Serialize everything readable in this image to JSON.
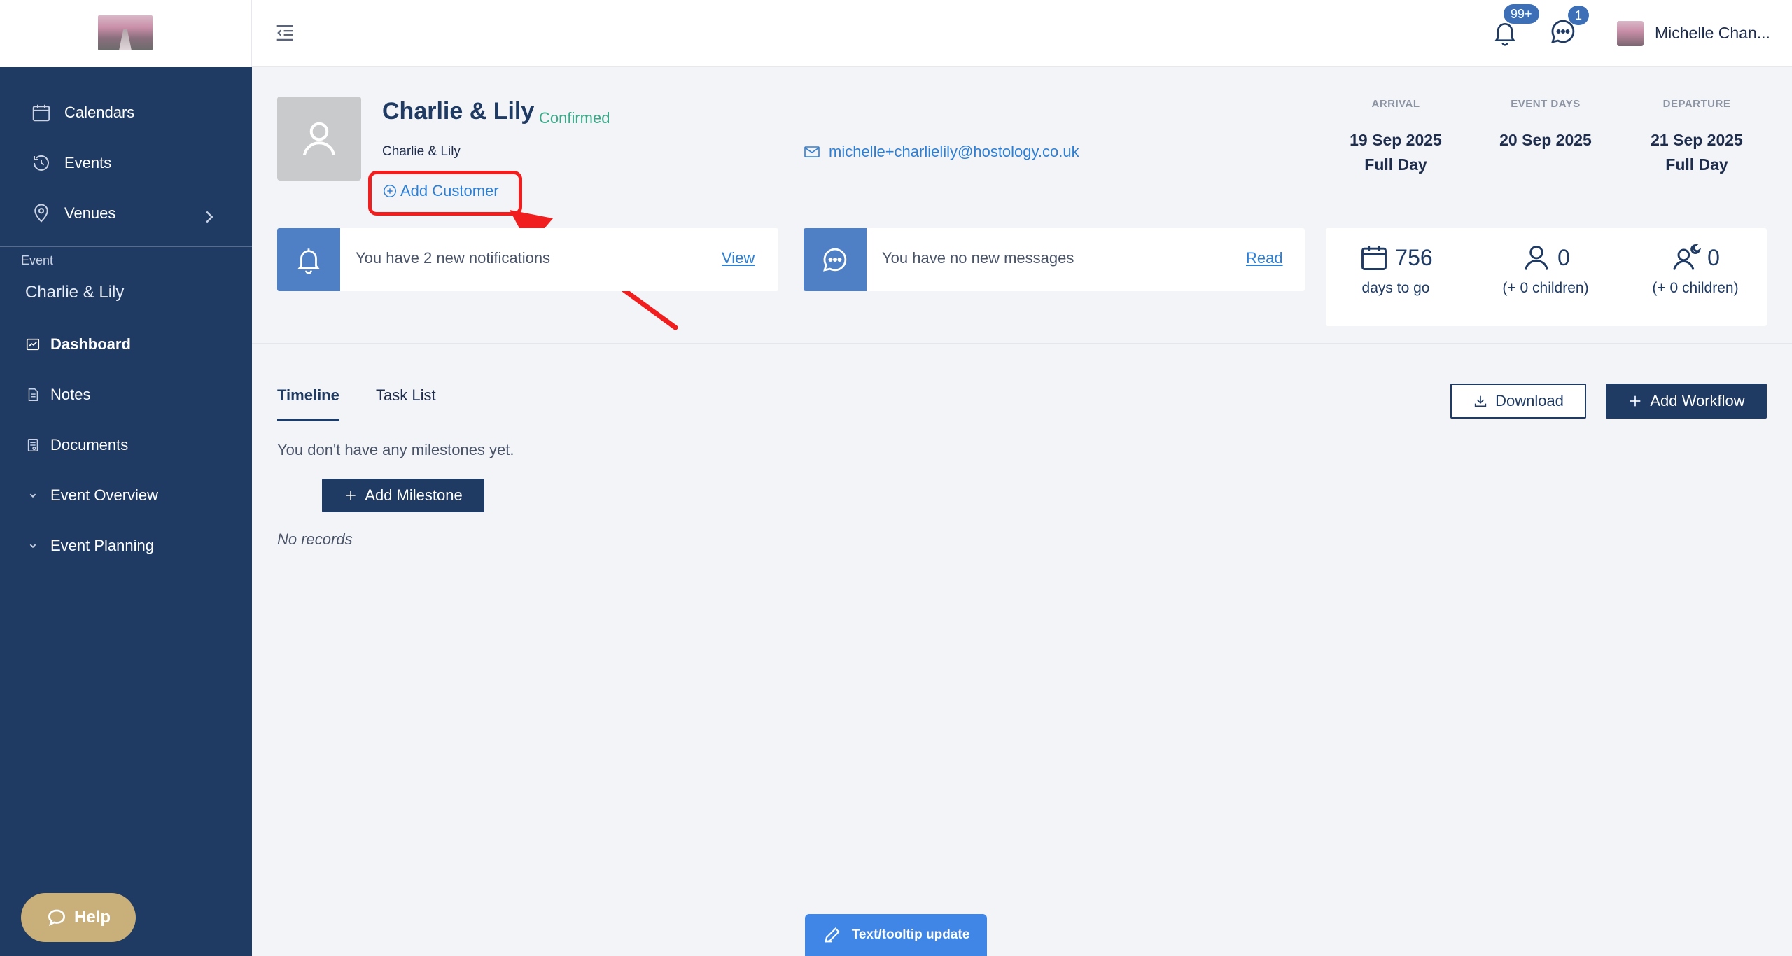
{
  "sidebar": {
    "nav": [
      {
        "label": "Calendars",
        "icon": "calendar-icon"
      },
      {
        "label": "Events",
        "icon": "clock-history-icon"
      },
      {
        "label": "Venues",
        "icon": "map-pin-icon"
      }
    ],
    "section_label": "Event",
    "event_name": "Charlie & Lily",
    "sub_nav": [
      {
        "label": "Dashboard",
        "icon": "dashboard-icon",
        "active": true
      },
      {
        "label": "Notes",
        "icon": "note-icon"
      },
      {
        "label": "Documents",
        "icon": "document-icon"
      },
      {
        "label": "Event Overview",
        "icon": "chevron-down-icon"
      },
      {
        "label": "Event Planning",
        "icon": "chevron-down-icon"
      }
    ],
    "help_label": "Help"
  },
  "topbar": {
    "notifications_badge": "99+",
    "messages_badge": "1",
    "user_name": "Michelle Chan..."
  },
  "event": {
    "title": "Charlie & Lily",
    "status": "Confirmed",
    "subtitle": "Charlie & Lily",
    "add_customer_label": "Add Customer",
    "email": "michelle+charlielily@hostology.co.uk",
    "dates": [
      {
        "label": "ARRIVAL",
        "value": "19 Sep 2025",
        "sub": "Full Day"
      },
      {
        "label": "EVENT DAYS",
        "value": "20 Sep 2025",
        "sub": ""
      },
      {
        "label": "DEPARTURE",
        "value": "21 Sep 2025",
        "sub": "Full Day"
      }
    ]
  },
  "cards": {
    "notifications": {
      "text": "You have 2 new notifications",
      "link": "View"
    },
    "messages": {
      "text": "You have no new messages",
      "link": "Read"
    }
  },
  "stats": [
    {
      "value": "756",
      "label": "days to go",
      "icon": "calendar-icon"
    },
    {
      "value": "0",
      "label": "(+ 0 children)",
      "icon": "person-icon"
    },
    {
      "value": "0",
      "label": "(+ 0 children)",
      "icon": "person-night-icon"
    }
  ],
  "tabs": [
    {
      "label": "Timeline",
      "active": true
    },
    {
      "label": "Task List",
      "active": false
    }
  ],
  "actions": {
    "download_label": "Download",
    "add_workflow_label": "Add Workflow",
    "add_milestone_label": "Add Milestone"
  },
  "timeline": {
    "empty_message": "You don't have any milestones yet.",
    "no_records": "No records"
  },
  "tooltip_tab_label": "Text/tooltip update",
  "colors": {
    "sidebar": "#1f3a63",
    "accent_blue": "#2d7fd4",
    "status_green": "#3aa789",
    "annotation_red": "#f01e1e"
  }
}
